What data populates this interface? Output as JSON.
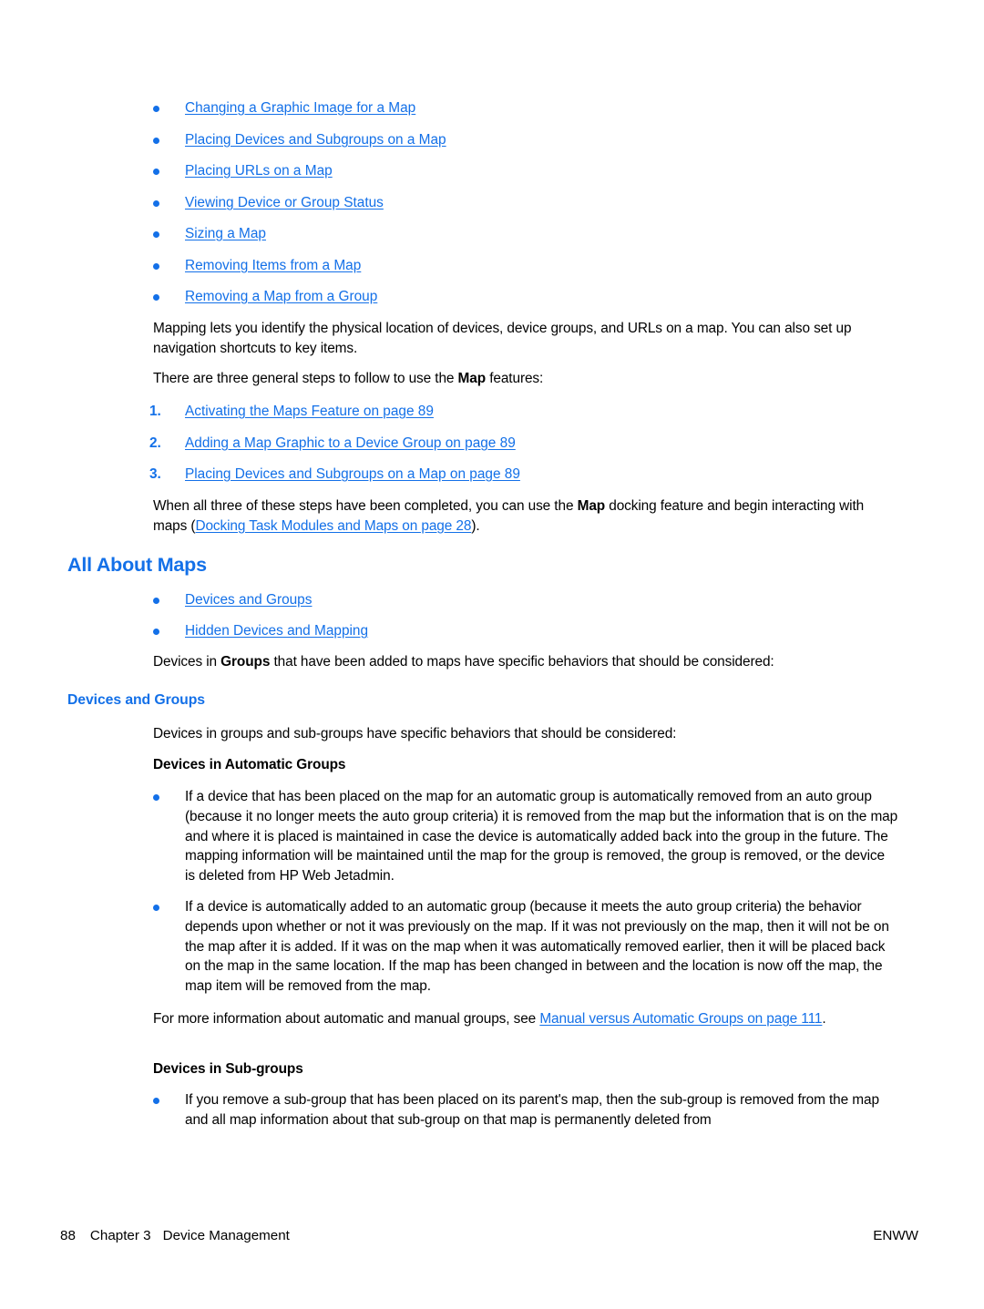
{
  "colors": {
    "link": "#1370e8",
    "heading": "#1370e8",
    "body": "#000000",
    "background": "#ffffff"
  },
  "top_link_list": [
    {
      "label": "Changing a Graphic Image for a Map"
    },
    {
      "label": "Placing Devices and Subgroups on a Map"
    },
    {
      "label": "Placing URLs on a Map"
    },
    {
      "label": "Viewing Device or Group Status"
    },
    {
      "label": "Sizing a Map"
    },
    {
      "label": "Removing Items from a Map"
    },
    {
      "label": "Removing a Map from a Group"
    }
  ],
  "intro": {
    "paragraph": "Mapping lets you identify the physical location of devices, device groups, and URLs on a map. You can also set up navigation shortcuts to key items.",
    "steps_lead_before": "There are three general steps to follow to use the ",
    "steps_lead_bold": "Map",
    "steps_lead_after": " features:"
  },
  "numbered_steps": [
    {
      "num": "1.",
      "label": "Activating the Maps Feature on page 89"
    },
    {
      "num": "2.",
      "label": "Adding a Map Graphic to a Device Group on page 89"
    },
    {
      "num": "3.",
      "label": "Placing Devices and Subgroups on a Map on page 89"
    }
  ],
  "after_steps": {
    "before_bold": "When all three of these steps have been completed, you can use the ",
    "bold": "Map",
    "after_bold": " docking feature and begin interacting with maps (",
    "link": "Docking Task Modules and Maps on page 28",
    "tail": ")."
  },
  "all_about_maps": {
    "heading": "All About Maps",
    "link_list": [
      {
        "label": "Devices and Groups"
      },
      {
        "label": "Hidden Devices and Mapping"
      }
    ],
    "lead_before": "Devices in ",
    "lead_bold": "Groups",
    "lead_after": " that have been added to maps have specific behaviors that should be considered:"
  },
  "devices_and_groups": {
    "heading": "Devices and Groups",
    "intro": "Devices in groups and sub-groups have specific behaviors that should be considered:",
    "automatic_groups_heading": "Devices in Automatic Groups",
    "automatic_bullets": [
      "If a device that has been placed on the map for an automatic group is automatically removed from an auto group (because it no longer meets the auto group criteria) it is removed from the map but the information that is on the map and where it is placed is maintained in case the device is automatically added back into the group in the future. The mapping information will be maintained until the map for the group is removed, the group is removed, or the device is deleted from HP Web Jetadmin.",
      "If a device is automatically added to an automatic group (because it meets the auto group criteria) the behavior depends upon whether or not it was previously on the map. If it was not previously on the map, then it will not be on the map after it is added. If it was on the map when it was automatically removed earlier, then it will be placed back on the map in the same location. If the map has been changed in between and the location is now off the map, the map item will be removed from the map."
    ],
    "more_info": {
      "before_link": "For more information about automatic and manual groups, see ",
      "link": "Manual versus Automatic Groups on page 111",
      "tail": "."
    },
    "subgroups_heading": "Devices in Sub-groups",
    "subgroup_bullets": [
      "If you remove a sub-group that has been placed on its parent's map, then the sub-group is removed from the map and all map information about that sub-group on that map is permanently deleted from"
    ]
  },
  "footer": {
    "page_number": "88",
    "chapter": "Chapter 3",
    "chapter_title": "Device Management",
    "locale": "ENWW"
  }
}
